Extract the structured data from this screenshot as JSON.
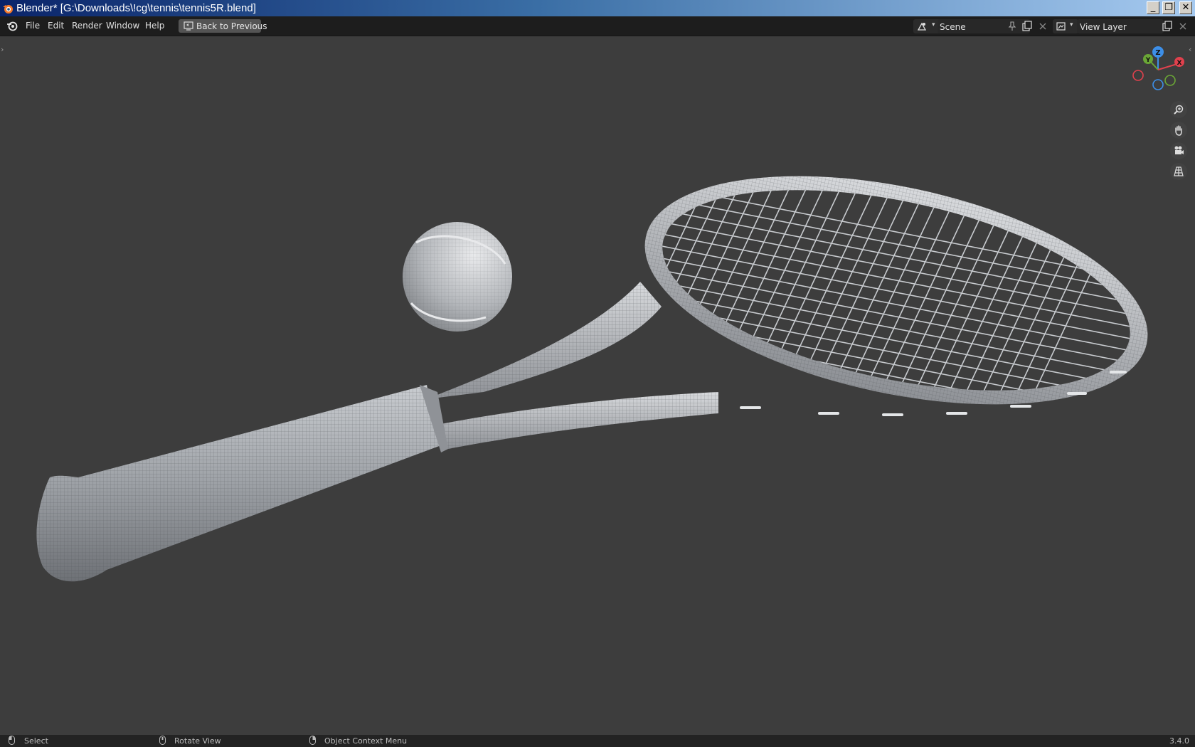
{
  "window": {
    "title": "Blender* [G:\\Downloads\\!cg\\tennis\\tennis5R.blend]",
    "minimize": "_",
    "restore": "❐",
    "close": "✕"
  },
  "menubar": {
    "items": [
      "File",
      "Edit",
      "Render",
      "Window",
      "Help"
    ],
    "back_button": "Back to Previous",
    "scene_label": "Scene",
    "view_layer_label": "View Layer"
  },
  "gizmo": {
    "z_label": "Z",
    "y_label": "Y",
    "x_label": "X"
  },
  "statusbar": {
    "select": "Select",
    "rotate": "Rotate View",
    "context_menu": "Object Context Menu",
    "version": "3.4.0"
  },
  "colors": {
    "viewport_bg": "#3d3d3d",
    "header_bg": "#1d1d1d",
    "x_axis": "#e0414d",
    "y_axis": "#6aa636",
    "z_axis": "#3d8fe8"
  },
  "icons": [
    "blender-logo-icon",
    "back-screen-icon",
    "scene-icon",
    "pin-icon",
    "duplicate-icon",
    "remove-icon",
    "view-layer-icon",
    "zoom-icon",
    "hand-pan-icon",
    "camera-icon",
    "grid-ortho-icon",
    "mouse-icon"
  ]
}
